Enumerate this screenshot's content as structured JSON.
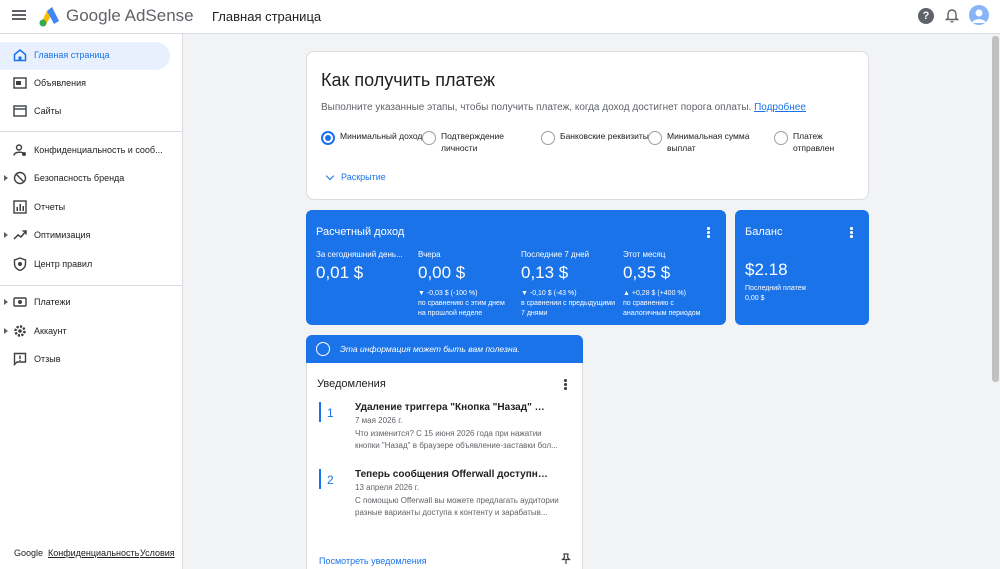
{
  "header": {
    "brand": "Google AdSense",
    "page_title": "Главная страница",
    "icons": [
      "menu-icon",
      "adsense-logo",
      "help-icon",
      "bell-icon",
      "avatar"
    ]
  },
  "sidebar": {
    "items": [
      {
        "label": "Главная страница",
        "icon": "home-icon",
        "active": true
      },
      {
        "label": "Объявления",
        "icon": "ads-icon"
      },
      {
        "label": "Сайты",
        "icon": "sites-icon"
      },
      {
        "label": "Конфиденциальность и сооб...",
        "icon": "privacy-icon"
      },
      {
        "label": "Безопасность бренда",
        "icon": "block-icon"
      },
      {
        "label": "Отчеты",
        "icon": "reports-icon"
      },
      {
        "label": "Оптимизация",
        "icon": "trending-icon"
      },
      {
        "label": "Центр правил",
        "icon": "policy-icon"
      },
      {
        "label": "Платежи",
        "icon": "payments-icon"
      },
      {
        "label": "Аккаунт",
        "icon": "gear-icon"
      },
      {
        "label": "Отзыв",
        "icon": "feedback-icon"
      }
    ],
    "footer": {
      "google": "Google",
      "privacy": "Конфиденциальность",
      "terms": "Условия"
    }
  },
  "payment": {
    "title": "Как получить платеж",
    "description": "Выполните указанные этапы, чтобы получить платеж, когда доход достигнет порога оплаты.",
    "more_link": "Подробнее",
    "steps": [
      {
        "label": "Минимальный доход",
        "done": true
      },
      {
        "label": "Подтверждение личности",
        "done": false
      },
      {
        "label": "Банковские реквизиты",
        "done": false
      },
      {
        "label": "Минимальная сумма выплат",
        "done": false
      },
      {
        "label": "Платеж отправлен",
        "done": false
      }
    ],
    "expand_label": "Раскрытие"
  },
  "revenue": {
    "title": "Расчетный доход",
    "columns": [
      {
        "label": "За сегодняшний день...",
        "value": "0,01 $",
        "change": "",
        "compare": ""
      },
      {
        "label": "Вчера",
        "value": "0,00 $",
        "change": "▼ -0,03 $ (-100 %)",
        "compare": "по сравнению с этим днем на прошлой неделе"
      },
      {
        "label": "Последние 7 дней",
        "value": "0,13 $",
        "change": "▼ -0,10 $ (-43 %)",
        "compare": "в сравнении с предыдущими 7 днями"
      },
      {
        "label": "Этот месяц",
        "value": "0,35 $",
        "change": "▲ +0,28 $ (+400 %)",
        "compare": "по сравнению с аналогичным периодом"
      }
    ]
  },
  "balance": {
    "title": "Баланс",
    "value": "$2.18",
    "last_payment_label": "Последний платеж",
    "last_payment_value": "0,00 $"
  },
  "info": {
    "text": "Эта информация может быть вам полезна."
  },
  "notifications": {
    "title": "Уведомления",
    "items": [
      {
        "num": "1",
        "title": "Удаление триггера \"Кнопка \"Назад\" в б...",
        "date": "7 мая 2026 г.",
        "body": "Что изменится? С 15 июня 2026 года при нажатии кнопки \"Назад\" в браузере объявление-заставки бол..."
      },
      {
        "num": "2",
        "title": "Теперь сообщения Offerwall доступны в...",
        "date": "13 апреля 2026 г.",
        "body": "С помощью Offerwall вы можете предлагать аудитории разные варианты доступа к контенту и зарабатыв..."
      }
    ],
    "view_link": "Посмотреть уведомления"
  }
}
